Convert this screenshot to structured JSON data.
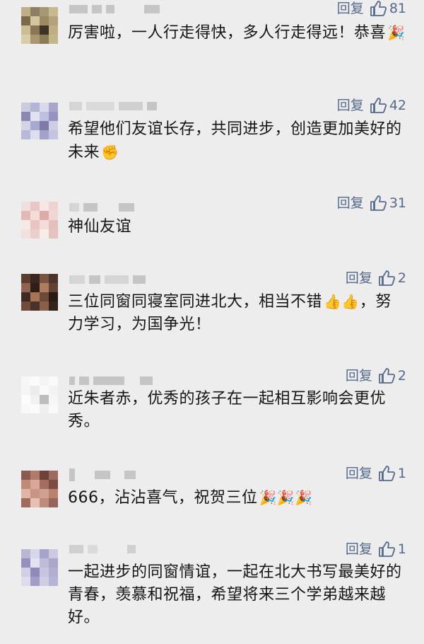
{
  "reply_label": "回复",
  "comments": [
    {
      "text": "厉害啦，一人行走得快，多人行走得远！恭喜",
      "emoji": "🎉",
      "likes": "81"
    },
    {
      "text": "希望他们友谊长存，共同进步，创造更加美好的未来",
      "emoji": "✊",
      "likes": "42"
    },
    {
      "text": "神仙友谊",
      "emoji": "",
      "likes": "31"
    },
    {
      "text_part1": "三位同窗同寝室同进北大，相当不错",
      "emoji": "👍👍",
      "text_part2": "，努力学习，为国争光！",
      "likes": "2"
    },
    {
      "text": "近朱者赤，优秀的孩子在一起相互影响会更优秀。",
      "emoji": "",
      "likes": "2"
    },
    {
      "text": "666，沾沾喜气，祝贺三位",
      "emoji": "🎉🎉🎉",
      "likes": "1"
    },
    {
      "text": "一起进步的同窗情谊，一起在北大书写最美好的青春，羡慕和祝福，希望将来三个学弟越来越好。",
      "emoji": "",
      "likes": "1"
    }
  ]
}
